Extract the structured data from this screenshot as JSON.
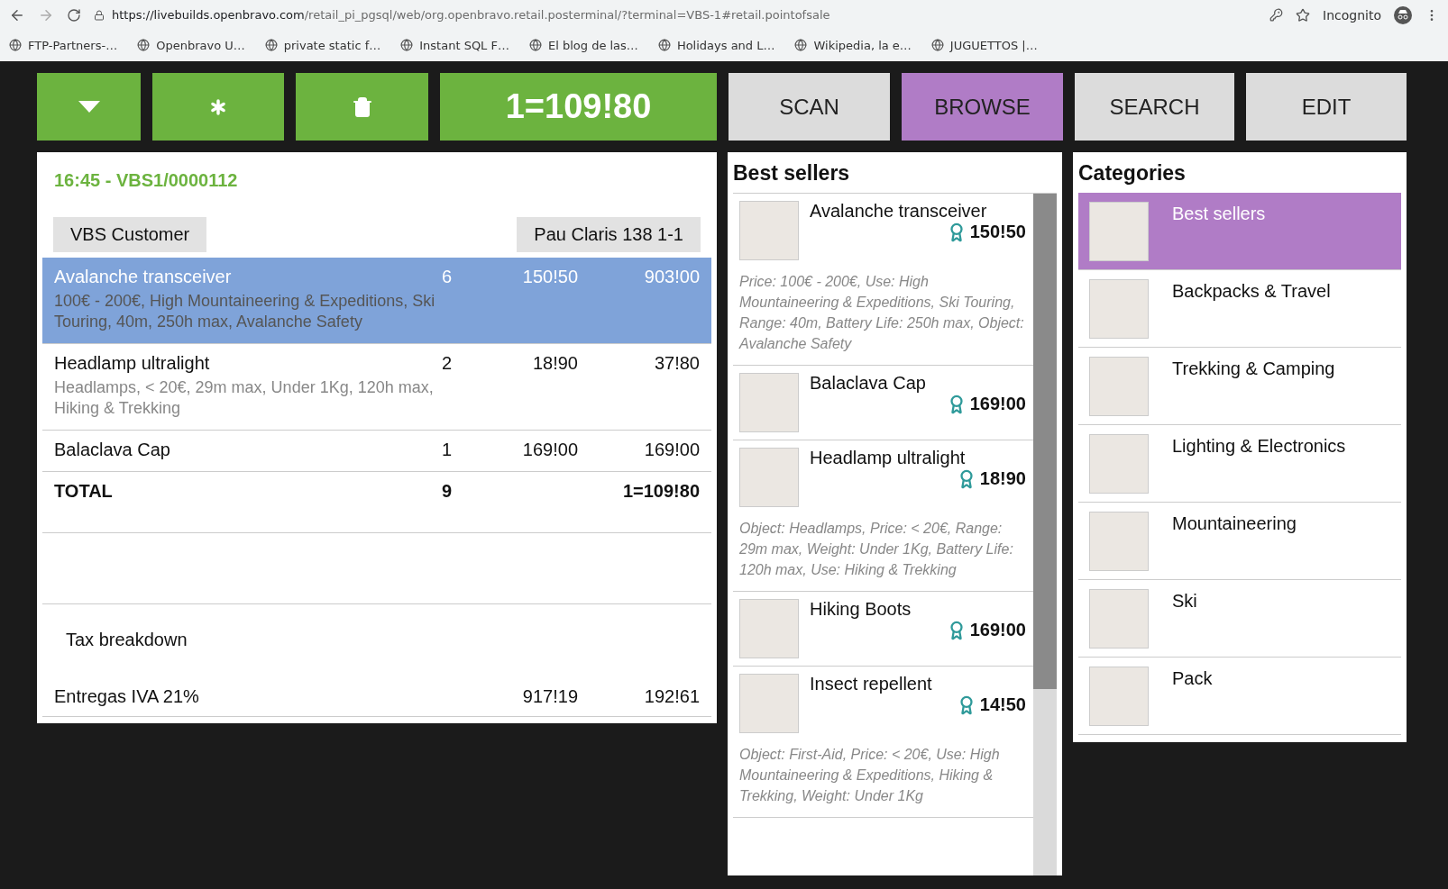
{
  "browser": {
    "url_host": "https://livebuilds.openbravo.com",
    "url_path": "/retail_pi_pgsql/web/org.openbravo.retail.posterminal/?terminal=VBS-1#retail.pointofsale",
    "incognito_label": "Incognito",
    "bookmarks": [
      {
        "label": "FTP-Partners-…"
      },
      {
        "label": "Openbravo U…"
      },
      {
        "label": "private static f…"
      },
      {
        "label": "Instant SQL F…"
      },
      {
        "label": "El blog de las…"
      },
      {
        "label": "Holidays and L…"
      },
      {
        "label": "Wikipedia, la e…"
      },
      {
        "label": "JUGUETTOS |…"
      }
    ]
  },
  "toolbar": {
    "actions": [
      {
        "kind": "menu"
      },
      {
        "kind": "asterisk"
      },
      {
        "kind": "delete"
      }
    ],
    "total": "1=109!80",
    "tabs": [
      {
        "label": "SCAN",
        "selected": false
      },
      {
        "label": "BROWSE",
        "selected": true
      },
      {
        "label": "SEARCH",
        "selected": false
      },
      {
        "label": "EDIT",
        "selected": false
      }
    ]
  },
  "order": {
    "header": "16:45 - VBS1/0000112",
    "customer": "VBS Customer",
    "address": "Pau Claris 138 1-1",
    "lines": [
      {
        "name": "Avalanche transceiver",
        "qty": "6",
        "price": "150!50",
        "total": "903!00",
        "description": "100€ - 200€, High Mountaineering & Expeditions, Ski Touring, 40m, 250h max, Avalanche Safety",
        "selected": true
      },
      {
        "name": "Headlamp ultralight",
        "qty": "2",
        "price": "18!90",
        "total": "37!80",
        "description": "Headlamps, < 20€, 29m max, Under 1Kg, 120h max, Hiking & Trekking",
        "selected": false
      },
      {
        "name": "Balaclava Cap",
        "qty": "1",
        "price": "169!00",
        "total": "169!00",
        "selected": false
      }
    ],
    "total": {
      "label": "TOTAL",
      "qty": "9",
      "amount": "1=109!80"
    },
    "tax": {
      "title": "Tax breakdown",
      "rows": [
        {
          "name": "Entregas IVA 21%",
          "base": "917!19",
          "amount": "192!61"
        }
      ]
    }
  },
  "best_sellers": {
    "title": "Best sellers",
    "items": [
      {
        "name": "Avalanche transceiver",
        "price": "150!50",
        "description": "Price: 100€ - 200€, Use: High Mountaineering & Expeditions, Ski Touring, Range: 40m, Battery Life: 250h max, Object: Avalanche Safety"
      },
      {
        "name": "Balaclava Cap",
        "price": "169!00"
      },
      {
        "name": "Headlamp ultralight",
        "price": "18!90",
        "description": "Object: Headlamps, Price: < 20€, Range: 29m max, Weight: Under 1Kg, Battery Life: 120h max, Use: Hiking & Trekking"
      },
      {
        "name": "Hiking Boots",
        "price": "169!00"
      },
      {
        "name": "Insect repellent",
        "price": "14!50",
        "description": "Object: First-Aid, Price: < 20€, Use: High Mountaineering & Expeditions, Hiking & Trekking, Weight: Under 1Kg"
      }
    ]
  },
  "categories": {
    "title": "Categories",
    "items": [
      {
        "name": "Best sellers",
        "selected": true
      },
      {
        "name": "Backpacks & Travel",
        "selected": false
      },
      {
        "name": "Trekking & Camping",
        "selected": false
      },
      {
        "name": "Lighting & Electronics",
        "selected": false
      },
      {
        "name": "Mountaineering",
        "selected": false
      },
      {
        "name": "Ski",
        "selected": false
      },
      {
        "name": "Pack",
        "selected": false
      }
    ]
  }
}
